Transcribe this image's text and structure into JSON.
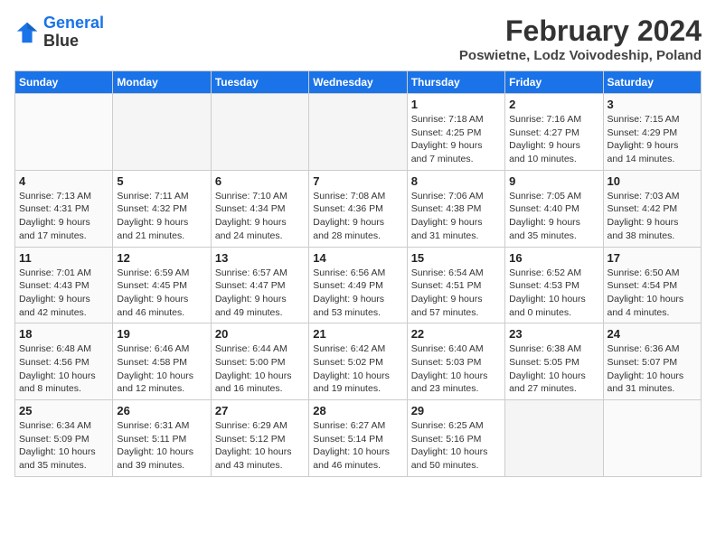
{
  "logo": {
    "line1": "General",
    "line2": "Blue"
  },
  "title": "February 2024",
  "subtitle": "Poswietne, Lodz Voivodeship, Poland",
  "days_of_week": [
    "Sunday",
    "Monday",
    "Tuesday",
    "Wednesday",
    "Thursday",
    "Friday",
    "Saturday"
  ],
  "weeks": [
    [
      {
        "day": "",
        "info": ""
      },
      {
        "day": "",
        "info": ""
      },
      {
        "day": "",
        "info": ""
      },
      {
        "day": "",
        "info": ""
      },
      {
        "day": "1",
        "info": "Sunrise: 7:18 AM\nSunset: 4:25 PM\nDaylight: 9 hours\nand 7 minutes."
      },
      {
        "day": "2",
        "info": "Sunrise: 7:16 AM\nSunset: 4:27 PM\nDaylight: 9 hours\nand 10 minutes."
      },
      {
        "day": "3",
        "info": "Sunrise: 7:15 AM\nSunset: 4:29 PM\nDaylight: 9 hours\nand 14 minutes."
      }
    ],
    [
      {
        "day": "4",
        "info": "Sunrise: 7:13 AM\nSunset: 4:31 PM\nDaylight: 9 hours\nand 17 minutes."
      },
      {
        "day": "5",
        "info": "Sunrise: 7:11 AM\nSunset: 4:32 PM\nDaylight: 9 hours\nand 21 minutes."
      },
      {
        "day": "6",
        "info": "Sunrise: 7:10 AM\nSunset: 4:34 PM\nDaylight: 9 hours\nand 24 minutes."
      },
      {
        "day": "7",
        "info": "Sunrise: 7:08 AM\nSunset: 4:36 PM\nDaylight: 9 hours\nand 28 minutes."
      },
      {
        "day": "8",
        "info": "Sunrise: 7:06 AM\nSunset: 4:38 PM\nDaylight: 9 hours\nand 31 minutes."
      },
      {
        "day": "9",
        "info": "Sunrise: 7:05 AM\nSunset: 4:40 PM\nDaylight: 9 hours\nand 35 minutes."
      },
      {
        "day": "10",
        "info": "Sunrise: 7:03 AM\nSunset: 4:42 PM\nDaylight: 9 hours\nand 38 minutes."
      }
    ],
    [
      {
        "day": "11",
        "info": "Sunrise: 7:01 AM\nSunset: 4:43 PM\nDaylight: 9 hours\nand 42 minutes."
      },
      {
        "day": "12",
        "info": "Sunrise: 6:59 AM\nSunset: 4:45 PM\nDaylight: 9 hours\nand 46 minutes."
      },
      {
        "day": "13",
        "info": "Sunrise: 6:57 AM\nSunset: 4:47 PM\nDaylight: 9 hours\nand 49 minutes."
      },
      {
        "day": "14",
        "info": "Sunrise: 6:56 AM\nSunset: 4:49 PM\nDaylight: 9 hours\nand 53 minutes."
      },
      {
        "day": "15",
        "info": "Sunrise: 6:54 AM\nSunset: 4:51 PM\nDaylight: 9 hours\nand 57 minutes."
      },
      {
        "day": "16",
        "info": "Sunrise: 6:52 AM\nSunset: 4:53 PM\nDaylight: 10 hours\nand 0 minutes."
      },
      {
        "day": "17",
        "info": "Sunrise: 6:50 AM\nSunset: 4:54 PM\nDaylight: 10 hours\nand 4 minutes."
      }
    ],
    [
      {
        "day": "18",
        "info": "Sunrise: 6:48 AM\nSunset: 4:56 PM\nDaylight: 10 hours\nand 8 minutes."
      },
      {
        "day": "19",
        "info": "Sunrise: 6:46 AM\nSunset: 4:58 PM\nDaylight: 10 hours\nand 12 minutes."
      },
      {
        "day": "20",
        "info": "Sunrise: 6:44 AM\nSunset: 5:00 PM\nDaylight: 10 hours\nand 16 minutes."
      },
      {
        "day": "21",
        "info": "Sunrise: 6:42 AM\nSunset: 5:02 PM\nDaylight: 10 hours\nand 19 minutes."
      },
      {
        "day": "22",
        "info": "Sunrise: 6:40 AM\nSunset: 5:03 PM\nDaylight: 10 hours\nand 23 minutes."
      },
      {
        "day": "23",
        "info": "Sunrise: 6:38 AM\nSunset: 5:05 PM\nDaylight: 10 hours\nand 27 minutes."
      },
      {
        "day": "24",
        "info": "Sunrise: 6:36 AM\nSunset: 5:07 PM\nDaylight: 10 hours\nand 31 minutes."
      }
    ],
    [
      {
        "day": "25",
        "info": "Sunrise: 6:34 AM\nSunset: 5:09 PM\nDaylight: 10 hours\nand 35 minutes."
      },
      {
        "day": "26",
        "info": "Sunrise: 6:31 AM\nSunset: 5:11 PM\nDaylight: 10 hours\nand 39 minutes."
      },
      {
        "day": "27",
        "info": "Sunrise: 6:29 AM\nSunset: 5:12 PM\nDaylight: 10 hours\nand 43 minutes."
      },
      {
        "day": "28",
        "info": "Sunrise: 6:27 AM\nSunset: 5:14 PM\nDaylight: 10 hours\nand 46 minutes."
      },
      {
        "day": "29",
        "info": "Sunrise: 6:25 AM\nSunset: 5:16 PM\nDaylight: 10 hours\nand 50 minutes."
      },
      {
        "day": "",
        "info": ""
      },
      {
        "day": "",
        "info": ""
      }
    ]
  ]
}
